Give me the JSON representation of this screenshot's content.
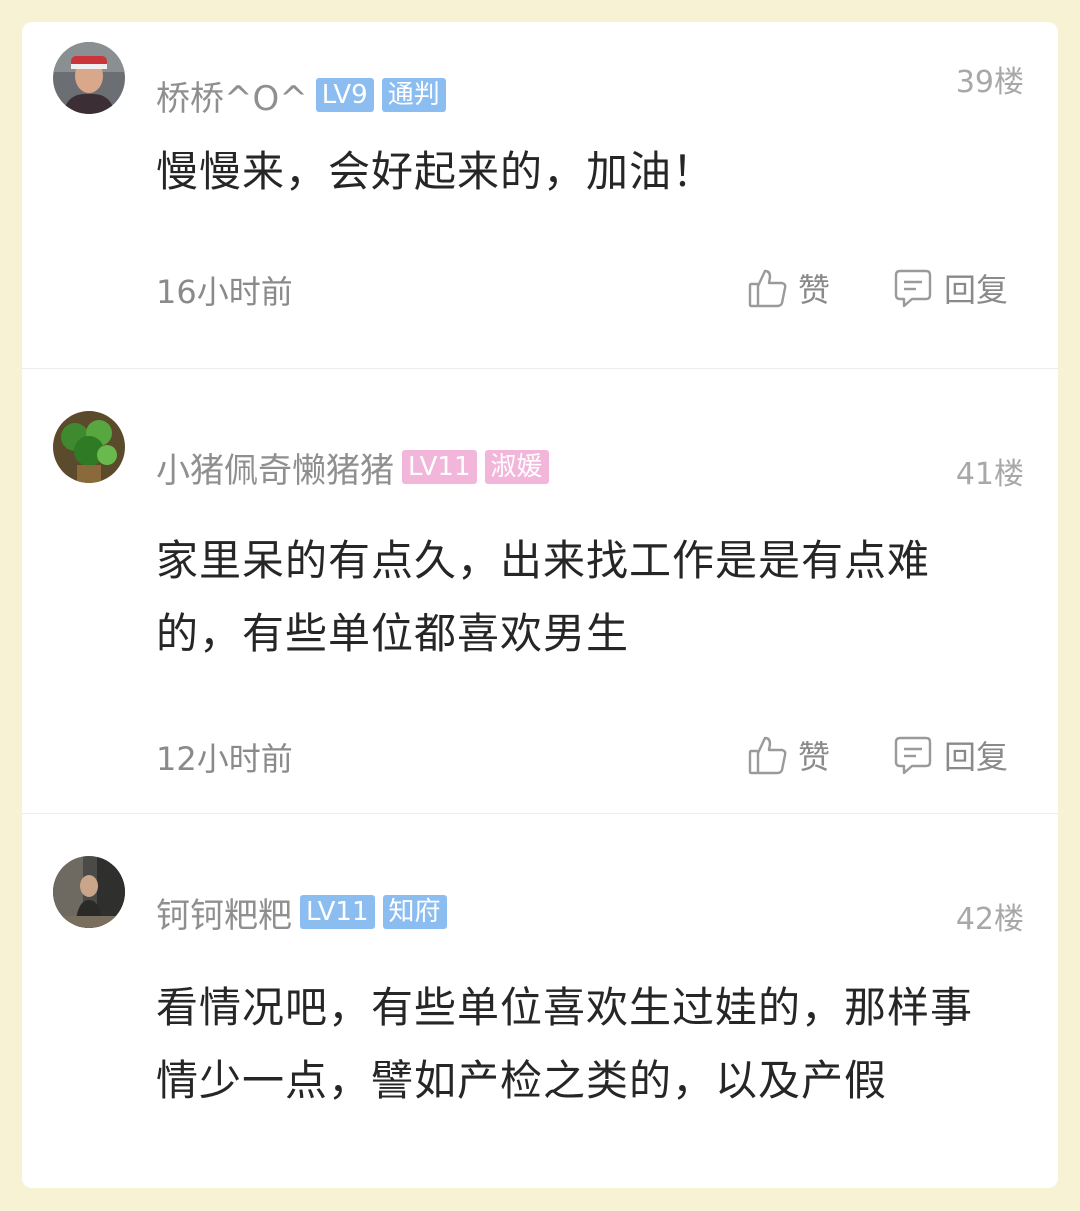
{
  "comments": [
    {
      "username": "桥桥^O^",
      "level": "LV9",
      "title": "通判",
      "badge_color": "#8cbdf1",
      "floor": "39楼",
      "content": "慢慢来，会好起来的，加油！",
      "time": "16小时前",
      "like_label": "赞",
      "reply_label": "回复"
    },
    {
      "username": "小猪佩奇懒猪猪",
      "level": "LV11",
      "title": "淑媛",
      "badge_color": "#f2b6db",
      "floor": "41楼",
      "content": "家里呆的有点久，出来找工作是是有点难的，有些单位都喜欢男生",
      "time": "12小时前",
      "like_label": "赞",
      "reply_label": "回复"
    },
    {
      "username": "钶钶粑粑",
      "level": "LV11",
      "title": "知府",
      "badge_color": "#8cbdf1",
      "floor": "42楼",
      "content": "看情况吧，有些单位喜欢生过娃的，那样事情少一点，譬如产检之类的，以及产假"
    }
  ]
}
